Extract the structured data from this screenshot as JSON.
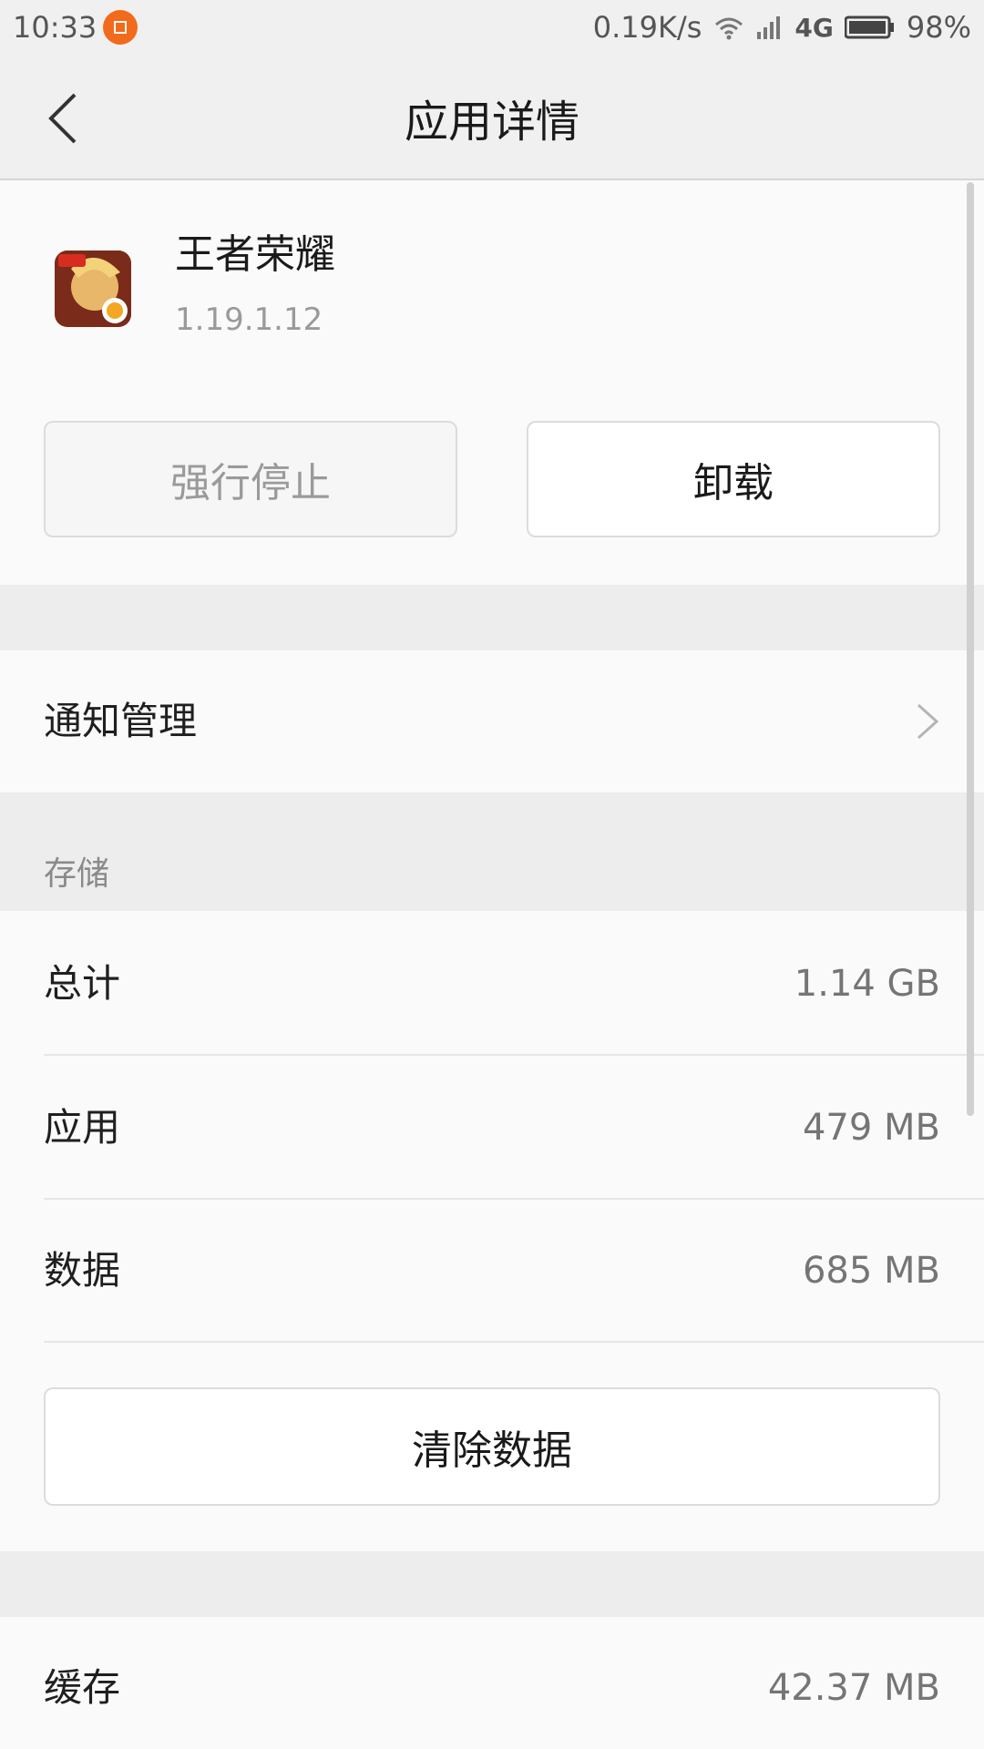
{
  "status_bar": {
    "time": "10:33",
    "network_speed": "0.19K/s",
    "network_type": "4G",
    "battery": "98%",
    "icons": [
      "notification-app-icon",
      "wifi-icon",
      "signal-icon",
      "battery-icon"
    ]
  },
  "header": {
    "title": "应用详情",
    "back_icon": "chevron-left-icon"
  },
  "app": {
    "name": "王者荣耀",
    "version": "1.19.1.12",
    "icon": "app-icon"
  },
  "actions": {
    "force_stop": "强行停止",
    "uninstall": "卸载"
  },
  "notifications": {
    "label": "通知管理",
    "icon": "chevron-right-icon"
  },
  "storage": {
    "section_title": "存储",
    "rows": [
      {
        "label": "总计",
        "value": "1.14 GB"
      },
      {
        "label": "应用",
        "value": "479 MB"
      },
      {
        "label": "数据",
        "value": "685 MB"
      }
    ],
    "clear_data": "清除数据"
  },
  "cache": {
    "label": "缓存",
    "value": "42.37 MB"
  },
  "colors": {
    "background": "#fafafa",
    "header_bg": "#f0f0f0",
    "separator": "#ededed",
    "notif_dot": "#f26a1b"
  }
}
